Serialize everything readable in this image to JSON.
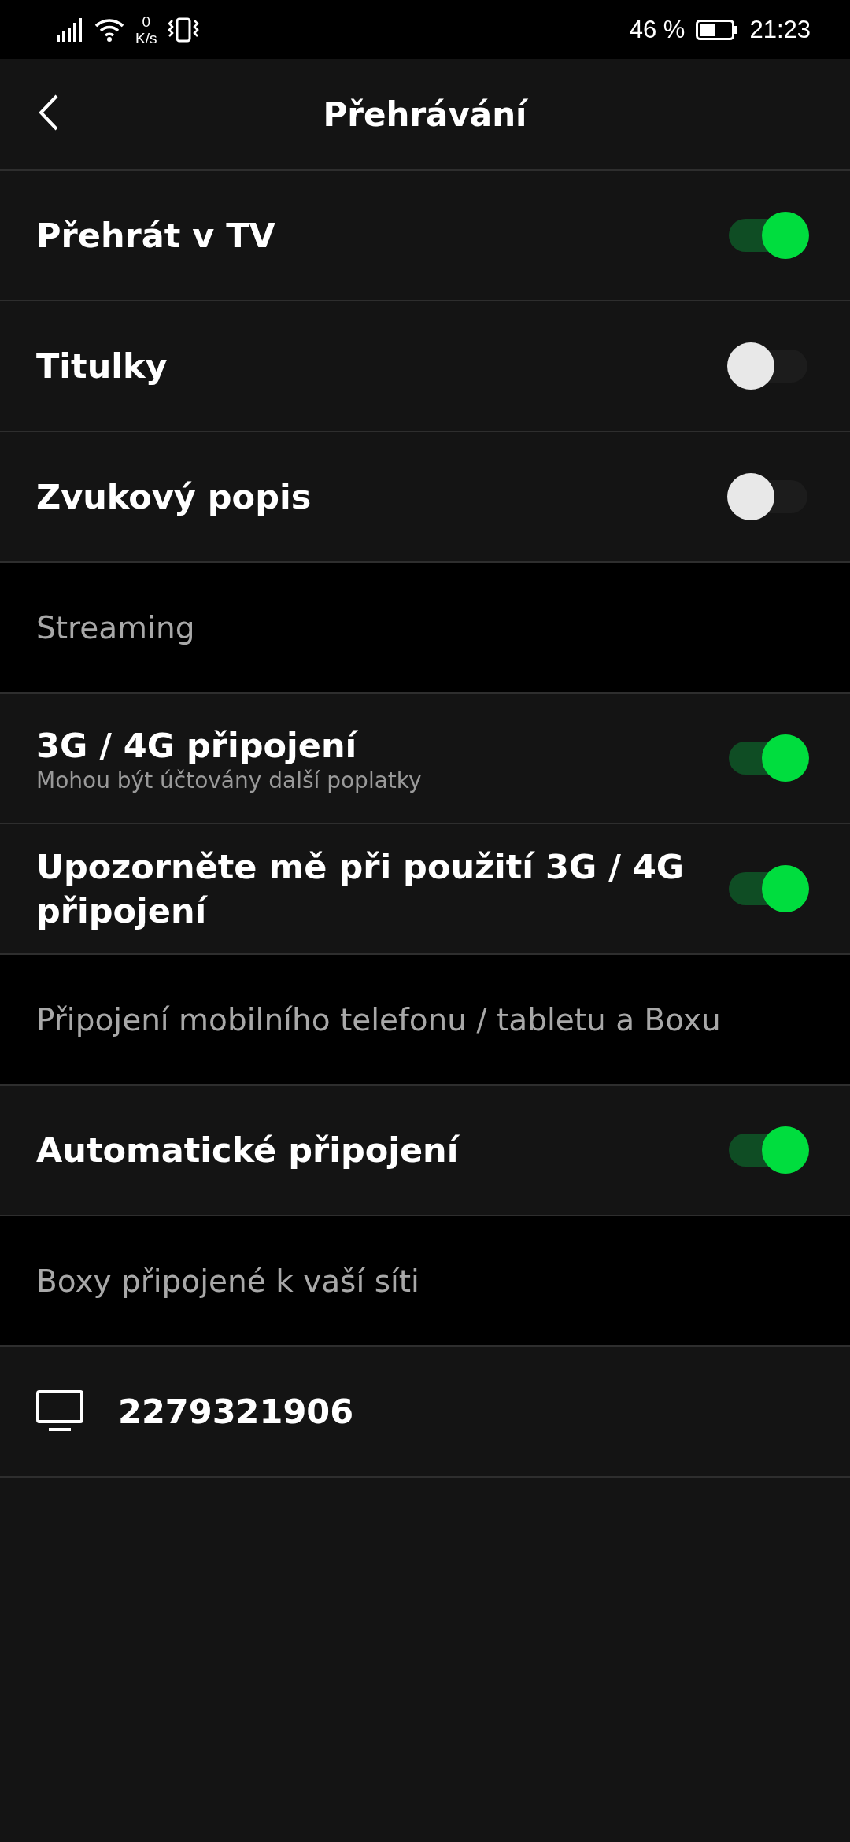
{
  "status_bar": {
    "speed_value": "0",
    "speed_unit": "K/s",
    "battery_text": "46 %",
    "time": "21:23"
  },
  "header": {
    "title": "Přehrávání"
  },
  "items": [
    {
      "kind": "toggle",
      "label": "Přehrát v TV",
      "on": true
    },
    {
      "kind": "toggle",
      "label": "Titulky",
      "on": false
    },
    {
      "kind": "toggle",
      "label": "Zvukový popis",
      "on": false
    },
    {
      "kind": "section",
      "label": "Streaming"
    },
    {
      "kind": "toggle",
      "label": "3G / 4G připojení",
      "subtitle": "Mohou být účtovány další poplatky",
      "on": true
    },
    {
      "kind": "toggle",
      "label": "Upozorněte mě při použití 3G / 4G připojení",
      "on": true
    },
    {
      "kind": "section",
      "label": "Připojení mobilního telefonu / tabletu a Boxu"
    },
    {
      "kind": "toggle",
      "label": "Automatické připojení",
      "on": true
    },
    {
      "kind": "section",
      "label": "Boxy připojené k vaší síti"
    },
    {
      "kind": "device",
      "label": "2279321906"
    }
  ]
}
